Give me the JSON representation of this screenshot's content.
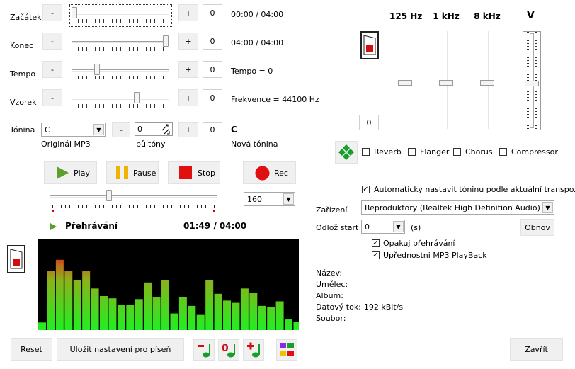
{
  "rows": [
    {
      "label": "Začátek",
      "minus": "-",
      "plus": "+",
      "value": "0",
      "info": "00:00 / 04:00",
      "pos": 0.0
    },
    {
      "label": "Konec",
      "minus": "-",
      "plus": "+",
      "value": "0",
      "info": "04:00 / 04:00",
      "pos": 1.0
    },
    {
      "label": "Tempo",
      "minus": "-",
      "plus": "+",
      "value": "0",
      "info": "Tempo = 0",
      "pos": 0.25
    },
    {
      "label": "Vzorek",
      "minus": "-",
      "plus": "+",
      "value": "0",
      "info": "Frekvence = 44100 Hz",
      "pos": 0.68
    }
  ],
  "key": {
    "label": "Tónina",
    "select": "C",
    "sublabel": "Originál MP3",
    "minus": "-",
    "semi": "0",
    "semi_label": "půltóny",
    "plus": "+",
    "value": "0",
    "new_key": "C",
    "new_key_label": "Nová tónina"
  },
  "transport": {
    "play": "Play",
    "pause": "Pause",
    "stop": "Stop",
    "rec": "Rec",
    "speed": "160",
    "progress": 0.35
  },
  "status": {
    "state": "Přehrávání",
    "time": "01:49 / 04:00"
  },
  "spectrum": [
    10,
    78,
    93,
    78,
    66,
    78,
    55,
    45,
    42,
    33,
    33,
    41,
    63,
    44,
    66,
    22,
    44,
    32,
    20,
    66,
    48,
    39,
    36,
    55,
    49,
    32,
    30,
    38,
    14,
    11
  ],
  "spectrum_max": 120,
  "eq": {
    "bands": [
      {
        "label": "125 Hz",
        "pos": 0.5
      },
      {
        "label": "1 kHz",
        "pos": 0.5
      },
      {
        "label": "8 kHz",
        "pos": 0.5
      }
    ],
    "volume_label": "V",
    "volume_pos": 0.5,
    "value": "0"
  },
  "effects": [
    {
      "label": "Reverb",
      "checked": false
    },
    {
      "label": "Flanger",
      "checked": false
    },
    {
      "label": "Chorus",
      "checked": false
    },
    {
      "label": "Compressor",
      "checked": false
    }
  ],
  "settings": {
    "auto_key": "Automaticky nastavit tóninu podle aktuální transpozice",
    "device_label": "Zařízení",
    "device": "Reproduktory (Realtek High Definition Audio)",
    "delay_label": "Odlož start",
    "delay": "0",
    "delay_unit": "(s)",
    "refresh": "Obnov",
    "repeat": "Opakuj přehrávání",
    "prefer": "Upřednostni MP3 PlayBack"
  },
  "info": [
    {
      "label": "Název:",
      "value": ""
    },
    {
      "label": "Umělec:",
      "value": ""
    },
    {
      "label": "Album:",
      "value": ""
    },
    {
      "label": "Datový tok:",
      "value": "192 kBit/s"
    },
    {
      "label": "Soubor:",
      "value": ""
    }
  ],
  "footer": {
    "reset": "Reset",
    "save": "Uložit nastavení pro píseň",
    "close": "Zavřít",
    "minus": "-",
    "zero": "0",
    "plus": "+"
  },
  "colors": {
    "play": "#5aa02c",
    "pause": "#f0b400",
    "stop": "#e01010",
    "rec": "#e01010",
    "diamond": "#16a02a"
  }
}
